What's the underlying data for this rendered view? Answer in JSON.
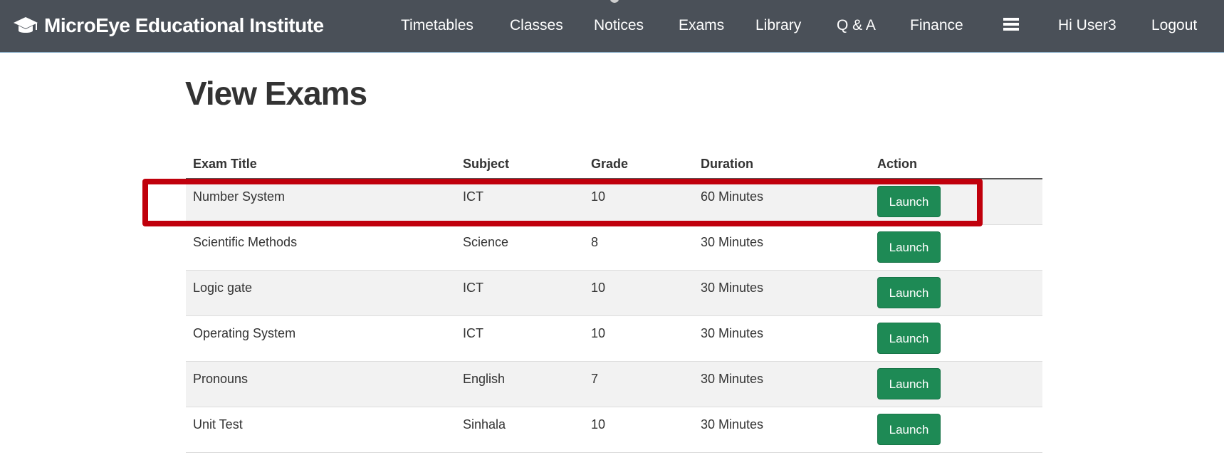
{
  "navbar": {
    "brand": "MicroEye Educational Institute",
    "brand_icon": "graduation-cap-icon",
    "items": [
      {
        "label": "Timetables"
      },
      {
        "label": "Classes"
      },
      {
        "label": "Notices"
      },
      {
        "label": "Exams"
      },
      {
        "label": "Library"
      },
      {
        "label": "Q & A"
      },
      {
        "label": "Finance"
      }
    ],
    "menu_icon": "hamburger-menu-icon",
    "greeting": "Hi User3",
    "logout": "Logout"
  },
  "main": {
    "title": "View Exams",
    "table": {
      "headers": [
        "Exam Title",
        "Subject",
        "Grade",
        "Duration",
        "Action"
      ],
      "rows": [
        {
          "title": "Number System",
          "subject": "ICT",
          "grade": "10",
          "duration": "60 Minutes",
          "action": "Launch"
        },
        {
          "title": "Scientific Methods",
          "subject": "Science",
          "grade": "8",
          "duration": "30 Minutes",
          "action": "Launch"
        },
        {
          "title": "Logic gate",
          "subject": "ICT",
          "grade": "10",
          "duration": "30 Minutes",
          "action": "Launch"
        },
        {
          "title": "Operating System",
          "subject": "ICT",
          "grade": "10",
          "duration": "30 Minutes",
          "action": "Launch"
        },
        {
          "title": "Pronouns",
          "subject": "English",
          "grade": "7",
          "duration": "30 Minutes",
          "action": "Launch"
        },
        {
          "title": "Unit Test",
          "subject": "Sinhala",
          "grade": "10",
          "duration": "30 Minutes",
          "action": "Launch"
        }
      ]
    }
  },
  "colors": {
    "navbar_bg": "#4a5058",
    "button_green": "#1e8a55",
    "highlight_red": "#c0000c",
    "row_stripe": "#f2f2f2"
  }
}
